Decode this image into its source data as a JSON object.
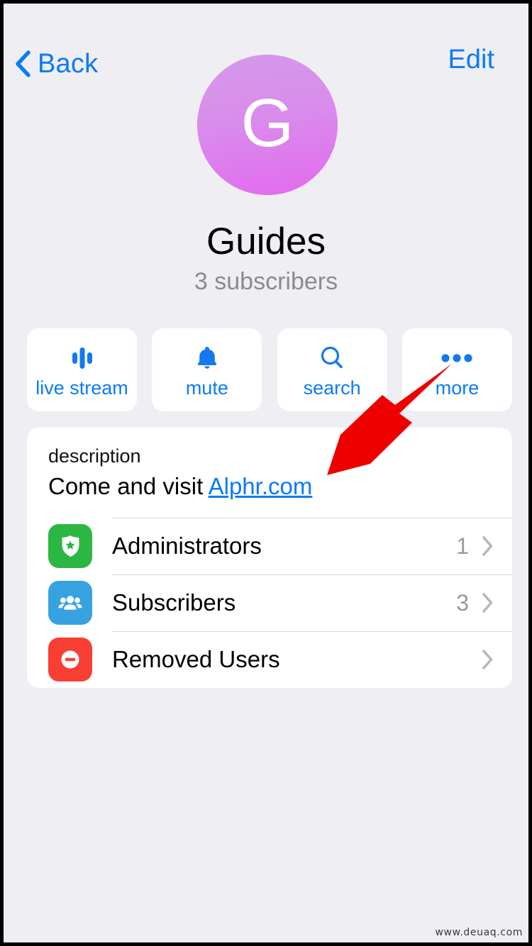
{
  "navbar": {
    "back_label": "Back",
    "back_icon": "chevron-left-icon",
    "edit_label": "Edit"
  },
  "profile": {
    "avatar_letter": "G",
    "avatar_gradient_from": "#d59ae9",
    "avatar_gradient_to": "#e369f0",
    "title": "Guides",
    "subtitle": "3 subscribers"
  },
  "actions": [
    {
      "label": "live stream",
      "icon": "live-stream-icon"
    },
    {
      "label": "mute",
      "icon": "bell-icon"
    },
    {
      "label": "search",
      "icon": "search-icon"
    },
    {
      "label": "more",
      "icon": "ellipsis-icon"
    }
  ],
  "description": {
    "label": "description",
    "text_prefix": "Come and visit ",
    "link_text": "Alphr.com"
  },
  "list_rows": [
    {
      "label": "Administrators",
      "count": "1",
      "icon": "shield-badge-icon",
      "icon_color": "#2cb742"
    },
    {
      "label": "Subscribers",
      "count": "3",
      "icon": "people-group-icon",
      "icon_color": "#36a3e0"
    },
    {
      "label": "Removed Users",
      "count": "",
      "icon": "minus-circle-icon",
      "icon_color": "#f93f33"
    }
  ],
  "annotation": {
    "arrow_color": "#ee0000",
    "points_to": "more"
  },
  "watermark": "www.deuaq.com",
  "theme": {
    "accent": "#0b7bf7",
    "background": "#efeef3",
    "card": "#ffffff",
    "separator": "#d9d9dd",
    "muted_text": "#8b8b90"
  }
}
